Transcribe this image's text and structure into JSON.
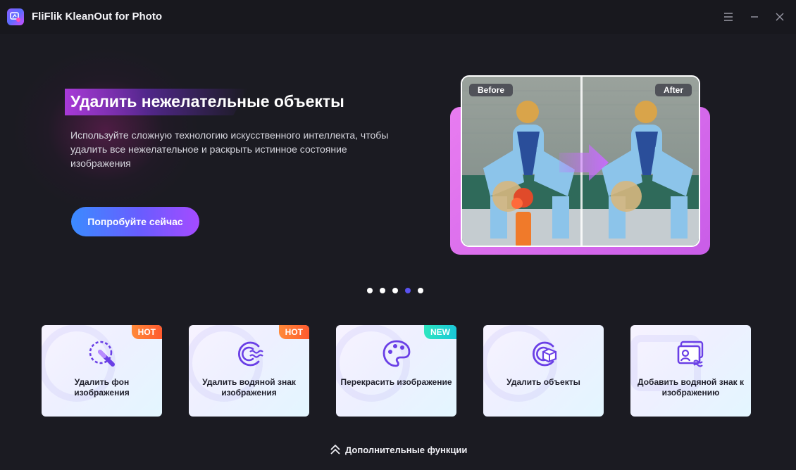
{
  "app": {
    "title": "FliFlik KleanOut for Photo"
  },
  "hero": {
    "title": "Удалить нежелательные объекты",
    "description": "Используйте сложную технологию искусственного интеллекта, чтобы удалить все нежелательное и раскрыть истинное состояние изображения",
    "cta_label": "Попробуйте сейчас",
    "before_label": "Before",
    "after_label": "After"
  },
  "carousel": {
    "count": 5,
    "active_index": 3
  },
  "features": [
    {
      "label": "Удалить фон изображения",
      "badge": "HOT",
      "icon": "brush-select-icon"
    },
    {
      "label": "Удалить водяной знак изображения",
      "badge": "HOT",
      "icon": "watermark-remove-icon"
    },
    {
      "label": "Перекрасить изображение",
      "badge": "NEW",
      "icon": "palette-icon"
    },
    {
      "label": "Удалить объекты",
      "badge": "",
      "icon": "object-remove-icon"
    },
    {
      "label": "Добавить водяной знак к изображению",
      "badge": "",
      "icon": "watermark-add-icon"
    }
  ],
  "more_label": "Дополнительные функции",
  "colors": {
    "accent": "#5a52f0",
    "cta_start": "#3b8bff",
    "cta_end": "#a54bff",
    "hot": "#ff6a30",
    "new": "#22d8c8"
  }
}
